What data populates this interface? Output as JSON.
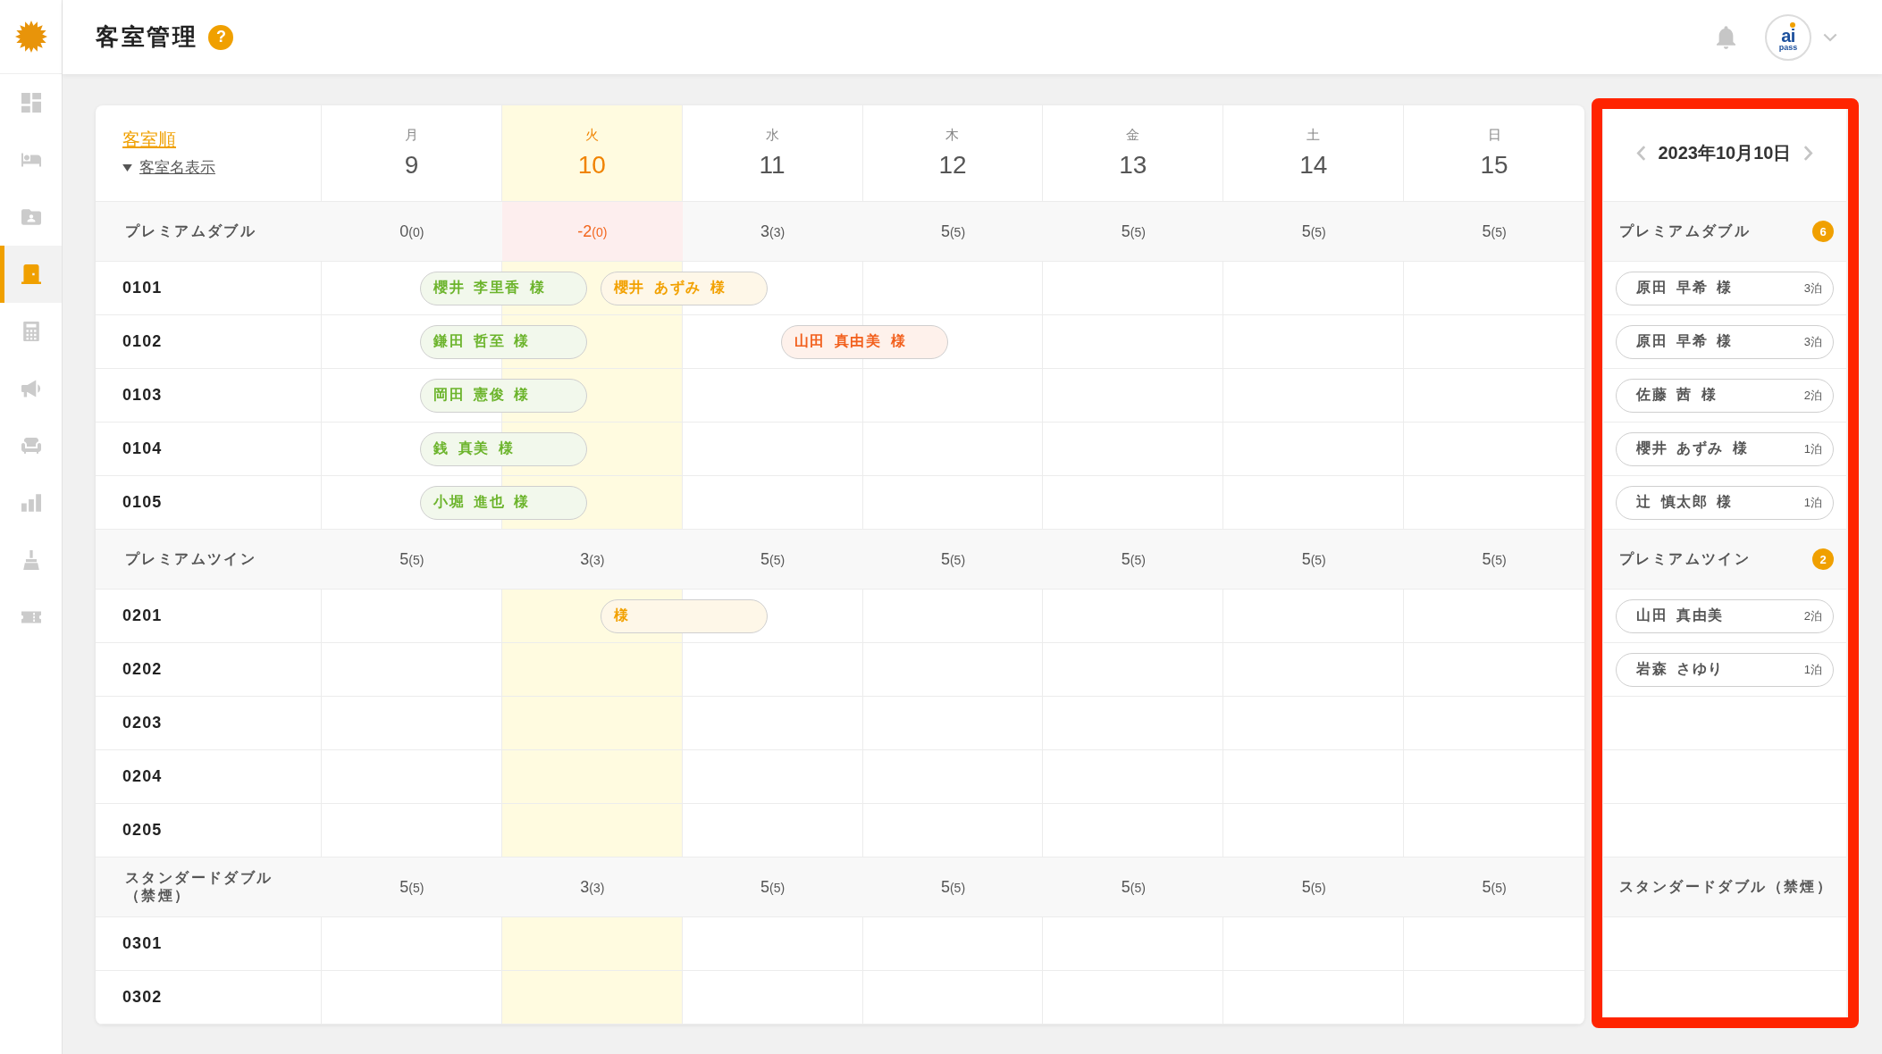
{
  "sidebar": {
    "items": [
      {
        "selected": false
      },
      {
        "selected": false
      },
      {
        "selected": false
      },
      {
        "selected": true
      },
      {
        "selected": false
      },
      {
        "selected": false
      },
      {
        "selected": false
      },
      {
        "selected": false
      },
      {
        "selected": false
      },
      {
        "selected": false
      }
    ]
  },
  "header": {
    "title": "客室管理",
    "help": "?",
    "account": {
      "logo_text": "ai",
      "logo_subtext": "pass"
    }
  },
  "calendar": {
    "sort_link": "客室順",
    "name_toggle": "客室名表示",
    "days": [
      {
        "weekday": "月",
        "day": "9",
        "selected": false
      },
      {
        "weekday": "火",
        "day": "10",
        "selected": true
      },
      {
        "weekday": "水",
        "day": "11",
        "selected": false
      },
      {
        "weekday": "木",
        "day": "12",
        "selected": false
      },
      {
        "weekday": "金",
        "day": "13",
        "selected": false
      },
      {
        "weekday": "土",
        "day": "14",
        "selected": false
      },
      {
        "weekday": "日",
        "day": "15",
        "selected": false
      }
    ],
    "groups": [
      {
        "name": "プレミアムダブル",
        "availability": [
          {
            "count": "0",
            "total": "(0)",
            "alert": false
          },
          {
            "count": "-2",
            "total": "(0)",
            "alert": true
          },
          {
            "count": "3",
            "total": "(3)",
            "alert": false
          },
          {
            "count": "5",
            "total": "(5)",
            "alert": false
          },
          {
            "count": "5",
            "total": "(5)",
            "alert": false
          },
          {
            "count": "5",
            "total": "(5)",
            "alert": false
          },
          {
            "count": "5",
            "total": "(5)",
            "alert": false
          }
        ],
        "rooms": [
          {
            "number": "0101",
            "nights": [
              {
                "kind": "booking",
                "guest": "櫻井 李里香 様",
                "color": "#6cb42c"
              },
              {
                "kind": "booking",
                "guest": "櫻井 あずみ 様",
                "color": "#f2a100"
              },
              {
                "kind": "vacant"
              },
              {
                "kind": "vacant"
              },
              {
                "kind": "vacant"
              },
              {
                "kind": "vacant"
              },
              {
                "kind": "vacant"
              }
            ]
          },
          {
            "number": "0102",
            "nights": [
              {
                "kind": "booking",
                "guest": "鎌田 哲至 様",
                "color": "#6cb42c"
              },
              {
                "kind": "vacant"
              },
              {
                "kind": "booking",
                "guest": "山田 真由美 様",
                "color": "#f2601d"
              },
              {
                "kind": "vacant"
              },
              {
                "kind": "vacant"
              },
              {
                "kind": "vacant"
              },
              {
                "kind": "vacant"
              }
            ]
          },
          {
            "number": "0103",
            "nights": [
              {
                "kind": "booking",
                "guest": "岡田 憲俊 様",
                "color": "#6cb42c"
              },
              {
                "kind": "vacant"
              },
              {
                "kind": "vacant"
              },
              {
                "kind": "vacant"
              },
              {
                "kind": "vacant"
              },
              {
                "kind": "vacant"
              },
              {
                "kind": "vacant"
              }
            ]
          },
          {
            "number": "0104",
            "nights": [
              {
                "kind": "booking",
                "guest": "銭 真美 様",
                "color": "#6cb42c"
              },
              {
                "kind": "vacant"
              },
              {
                "kind": "vacant"
              },
              {
                "kind": "vacant"
              },
              {
                "kind": "vacant"
              },
              {
                "kind": "vacant"
              },
              {
                "kind": "vacant"
              }
            ]
          },
          {
            "number": "0105",
            "nights": [
              {
                "kind": "booking",
                "guest": "小堀 進也 様",
                "color": "#6cb42c"
              },
              {
                "kind": "vacant"
              },
              {
                "kind": "vacant"
              },
              {
                "kind": "vacant"
              },
              {
                "kind": "vacant"
              },
              {
                "kind": "vacant"
              },
              {
                "kind": "vacant"
              }
            ]
          }
        ]
      },
      {
        "name": "プレミアムツイン",
        "availability": [
          {
            "count": "5",
            "total": "(5)",
            "alert": false
          },
          {
            "count": "3",
            "total": "(3)",
            "alert": false
          },
          {
            "count": "5",
            "total": "(5)",
            "alert": false
          },
          {
            "count": "5",
            "total": "(5)",
            "alert": false
          },
          {
            "count": "5",
            "total": "(5)",
            "alert": false
          },
          {
            "count": "5",
            "total": "(5)",
            "alert": false
          },
          {
            "count": "5",
            "total": "(5)",
            "alert": false
          }
        ],
        "rooms": [
          {
            "number": "0201",
            "nights": [
              {
                "kind": "vacant"
              },
              {
                "kind": "booking",
                "guest": "様",
                "color": "#f2a100"
              },
              {
                "kind": "vacant"
              },
              {
                "kind": "vacant"
              },
              {
                "kind": "vacant"
              },
              {
                "kind": "vacant"
              },
              {
                "kind": "vacant"
              }
            ]
          },
          {
            "number": "0202",
            "nights": [
              {
                "kind": "vacant"
              },
              {
                "kind": "vacant"
              },
              {
                "kind": "vacant"
              },
              {
                "kind": "vacant"
              },
              {
                "kind": "vacant"
              },
              {
                "kind": "vacant"
              },
              {
                "kind": "vacant"
              }
            ]
          },
          {
            "number": "0203",
            "nights": [
              {
                "kind": "vacant"
              },
              {
                "kind": "vacant"
              },
              {
                "kind": "vacant"
              },
              {
                "kind": "vacant"
              },
              {
                "kind": "vacant"
              },
              {
                "kind": "vacant"
              },
              {
                "kind": "vacant"
              }
            ]
          },
          {
            "number": "0204",
            "nights": [
              {
                "kind": "vacant"
              },
              {
                "kind": "vacant"
              },
              {
                "kind": "vacant"
              },
              {
                "kind": "vacant"
              },
              {
                "kind": "vacant"
              },
              {
                "kind": "vacant"
              },
              {
                "kind": "vacant"
              }
            ]
          },
          {
            "number": "0205",
            "nights": [
              {
                "kind": "vacant"
              },
              {
                "kind": "vacant"
              },
              {
                "kind": "vacant"
              },
              {
                "kind": "vacant"
              },
              {
                "kind": "vacant"
              },
              {
                "kind": "vacant"
              },
              {
                "kind": "vacant"
              }
            ]
          }
        ]
      },
      {
        "name": "スタンダードダブル（禁煙）",
        "availability": [
          {
            "count": "5",
            "total": "(5)",
            "alert": false
          },
          {
            "count": "3",
            "total": "(3)",
            "alert": false
          },
          {
            "count": "5",
            "total": "(5)",
            "alert": false
          },
          {
            "count": "5",
            "total": "(5)",
            "alert": false
          },
          {
            "count": "5",
            "total": "(5)",
            "alert": false
          },
          {
            "count": "5",
            "total": "(5)",
            "alert": false
          },
          {
            "count": "5",
            "total": "(5)",
            "alert": false
          }
        ],
        "rooms": [
          {
            "number": "0301",
            "nights": [
              {
                "kind": "vacant"
              },
              {
                "kind": "vacant"
              },
              {
                "kind": "vacant"
              },
              {
                "kind": "vacant"
              },
              {
                "kind": "vacant"
              },
              {
                "kind": "vacant"
              },
              {
                "kind": "vacant"
              }
            ]
          },
          {
            "number": "0302",
            "nights": [
              {
                "kind": "vacant"
              },
              {
                "kind": "vacant"
              },
              {
                "kind": "vacant"
              },
              {
                "kind": "vacant"
              },
              {
                "kind": "vacant"
              },
              {
                "kind": "vacant"
              },
              {
                "kind": "vacant"
              }
            ]
          }
        ]
      }
    ]
  },
  "day_panel": {
    "date": "2023年10月10日",
    "groups": [
      {
        "name": "プレミアムダブル",
        "count": "6",
        "guests": [
          {
            "name": "原田 早希 様",
            "nights": "3泊"
          },
          {
            "name": "原田 早希 様",
            "nights": "3泊"
          },
          {
            "name": "佐藤 茜 様",
            "nights": "2泊"
          },
          {
            "name": "櫻井 あずみ 様",
            "nights": "1泊"
          },
          {
            "name": "辻 慎太郎 様",
            "nights": "1泊"
          }
        ]
      },
      {
        "name": "プレミアムツイン",
        "count": "2",
        "guests": [
          {
            "name": "山田 真由美",
            "nights": "2泊"
          },
          {
            "name": "岩森 さゆり",
            "nights": "1泊"
          }
        ]
      },
      {
        "name": "スタンダードダブル（禁煙）"
      }
    ]
  }
}
